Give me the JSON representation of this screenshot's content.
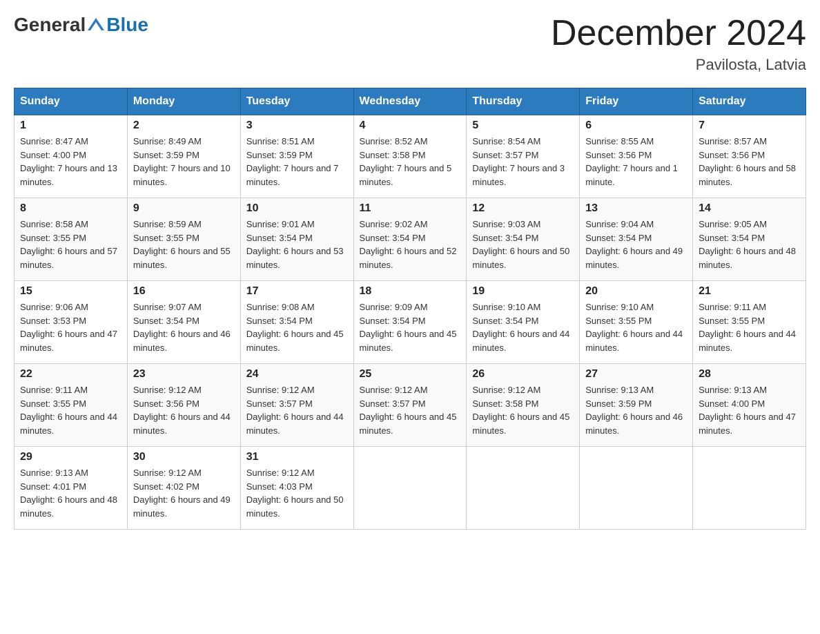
{
  "header": {
    "logo_general": "General",
    "logo_blue": "Blue",
    "month_title": "December 2024",
    "location": "Pavilosta, Latvia"
  },
  "days_of_week": [
    "Sunday",
    "Monday",
    "Tuesday",
    "Wednesday",
    "Thursday",
    "Friday",
    "Saturday"
  ],
  "weeks": [
    [
      {
        "day": "1",
        "sunrise": "8:47 AM",
        "sunset": "4:00 PM",
        "daylight": "7 hours and 13 minutes."
      },
      {
        "day": "2",
        "sunrise": "8:49 AM",
        "sunset": "3:59 PM",
        "daylight": "7 hours and 10 minutes."
      },
      {
        "day": "3",
        "sunrise": "8:51 AM",
        "sunset": "3:59 PM",
        "daylight": "7 hours and 7 minutes."
      },
      {
        "day": "4",
        "sunrise": "8:52 AM",
        "sunset": "3:58 PM",
        "daylight": "7 hours and 5 minutes."
      },
      {
        "day": "5",
        "sunrise": "8:54 AM",
        "sunset": "3:57 PM",
        "daylight": "7 hours and 3 minutes."
      },
      {
        "day": "6",
        "sunrise": "8:55 AM",
        "sunset": "3:56 PM",
        "daylight": "7 hours and 1 minute."
      },
      {
        "day": "7",
        "sunrise": "8:57 AM",
        "sunset": "3:56 PM",
        "daylight": "6 hours and 58 minutes."
      }
    ],
    [
      {
        "day": "8",
        "sunrise": "8:58 AM",
        "sunset": "3:55 PM",
        "daylight": "6 hours and 57 minutes."
      },
      {
        "day": "9",
        "sunrise": "8:59 AM",
        "sunset": "3:55 PM",
        "daylight": "6 hours and 55 minutes."
      },
      {
        "day": "10",
        "sunrise": "9:01 AM",
        "sunset": "3:54 PM",
        "daylight": "6 hours and 53 minutes."
      },
      {
        "day": "11",
        "sunrise": "9:02 AM",
        "sunset": "3:54 PM",
        "daylight": "6 hours and 52 minutes."
      },
      {
        "day": "12",
        "sunrise": "9:03 AM",
        "sunset": "3:54 PM",
        "daylight": "6 hours and 50 minutes."
      },
      {
        "day": "13",
        "sunrise": "9:04 AM",
        "sunset": "3:54 PM",
        "daylight": "6 hours and 49 minutes."
      },
      {
        "day": "14",
        "sunrise": "9:05 AM",
        "sunset": "3:54 PM",
        "daylight": "6 hours and 48 minutes."
      }
    ],
    [
      {
        "day": "15",
        "sunrise": "9:06 AM",
        "sunset": "3:53 PM",
        "daylight": "6 hours and 47 minutes."
      },
      {
        "day": "16",
        "sunrise": "9:07 AM",
        "sunset": "3:54 PM",
        "daylight": "6 hours and 46 minutes."
      },
      {
        "day": "17",
        "sunrise": "9:08 AM",
        "sunset": "3:54 PM",
        "daylight": "6 hours and 45 minutes."
      },
      {
        "day": "18",
        "sunrise": "9:09 AM",
        "sunset": "3:54 PM",
        "daylight": "6 hours and 45 minutes."
      },
      {
        "day": "19",
        "sunrise": "9:10 AM",
        "sunset": "3:54 PM",
        "daylight": "6 hours and 44 minutes."
      },
      {
        "day": "20",
        "sunrise": "9:10 AM",
        "sunset": "3:55 PM",
        "daylight": "6 hours and 44 minutes."
      },
      {
        "day": "21",
        "sunrise": "9:11 AM",
        "sunset": "3:55 PM",
        "daylight": "6 hours and 44 minutes."
      }
    ],
    [
      {
        "day": "22",
        "sunrise": "9:11 AM",
        "sunset": "3:55 PM",
        "daylight": "6 hours and 44 minutes."
      },
      {
        "day": "23",
        "sunrise": "9:12 AM",
        "sunset": "3:56 PM",
        "daylight": "6 hours and 44 minutes."
      },
      {
        "day": "24",
        "sunrise": "9:12 AM",
        "sunset": "3:57 PM",
        "daylight": "6 hours and 44 minutes."
      },
      {
        "day": "25",
        "sunrise": "9:12 AM",
        "sunset": "3:57 PM",
        "daylight": "6 hours and 45 minutes."
      },
      {
        "day": "26",
        "sunrise": "9:12 AM",
        "sunset": "3:58 PM",
        "daylight": "6 hours and 45 minutes."
      },
      {
        "day": "27",
        "sunrise": "9:13 AM",
        "sunset": "3:59 PM",
        "daylight": "6 hours and 46 minutes."
      },
      {
        "day": "28",
        "sunrise": "9:13 AM",
        "sunset": "4:00 PM",
        "daylight": "6 hours and 47 minutes."
      }
    ],
    [
      {
        "day": "29",
        "sunrise": "9:13 AM",
        "sunset": "4:01 PM",
        "daylight": "6 hours and 48 minutes."
      },
      {
        "day": "30",
        "sunrise": "9:12 AM",
        "sunset": "4:02 PM",
        "daylight": "6 hours and 49 minutes."
      },
      {
        "day": "31",
        "sunrise": "9:12 AM",
        "sunset": "4:03 PM",
        "daylight": "6 hours and 50 minutes."
      },
      null,
      null,
      null,
      null
    ]
  ],
  "labels": {
    "sunrise": "Sunrise:",
    "sunset": "Sunset:",
    "daylight": "Daylight:"
  }
}
